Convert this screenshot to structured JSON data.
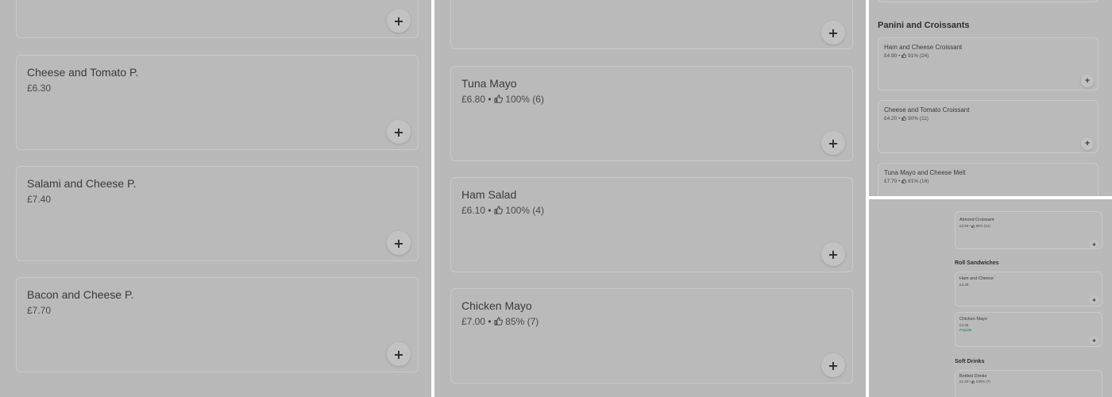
{
  "panel1": {
    "items": [
      {
        "name": "Cheese and Tomato P.",
        "price": "£6.30"
      },
      {
        "name": "Salami and Cheese P.",
        "price": "£7.40"
      },
      {
        "name": "Bacon and Cheese P.",
        "price": "£7.70"
      }
    ],
    "add_label": "+"
  },
  "panel2": {
    "items": [
      {
        "name": "Tuna Mayo",
        "price": "£6.80",
        "sep": "•",
        "rating": "100% (6)"
      },
      {
        "name": "Ham Salad",
        "price": "£6.10",
        "sep": "•",
        "rating": "100% (4)"
      },
      {
        "name": "Chicken Mayo",
        "price": "£7.00",
        "sep": "•",
        "rating": "85% (7)"
      }
    ],
    "add_label": "+"
  },
  "panel3": {
    "section_title": "Panini and Croissants",
    "items": [
      {
        "name": "Ham and Cheese Croissant",
        "price": "£4.90",
        "sep": "•",
        "rating": "91% (24)"
      },
      {
        "name": "Cheese and Tomato Croissant",
        "price": "£4.20",
        "sep": "•",
        "rating": "90% (11)"
      },
      {
        "name": "Tuna Mayo and Cheese Melt",
        "price": "£7.70",
        "sep": "•",
        "rating": "81% (16)"
      }
    ],
    "add_label": "+"
  },
  "panel4": {
    "almond": {
      "name": "Almond Croissant",
      "price": "£3.90",
      "sep": "•",
      "rating": "85% (12)"
    },
    "roll_title": "Roll Sandwiches",
    "roll_items": [
      {
        "name": "Ham and Cheese",
        "price": "£4.30"
      },
      {
        "name": "Chicken Mayo",
        "price": "£4.35",
        "badge": "Popular"
      }
    ],
    "drinks_title": "Soft Drinks",
    "drink": {
      "name": "Bottled Drinks",
      "price": "£1.40",
      "sep": "•",
      "rating": "100% (7)"
    },
    "add_label": "+"
  }
}
